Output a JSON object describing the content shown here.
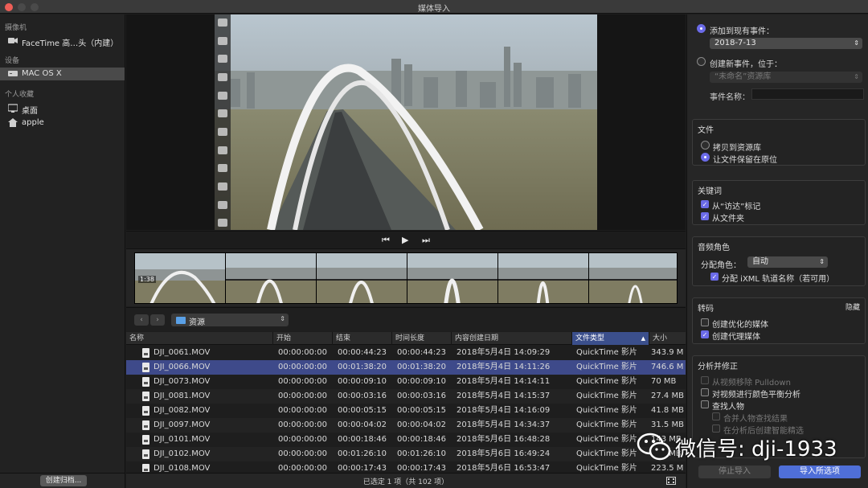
{
  "window": {
    "title": "媒体导入"
  },
  "sidebar": {
    "sections": [
      {
        "header": "摄像机",
        "items": [
          {
            "label": "FaceTime 高…头（内建）",
            "icon": "camera-icon"
          }
        ]
      },
      {
        "header": "设备",
        "items": [
          {
            "label": "MAC OS X",
            "icon": "drive-icon",
            "selected": true
          }
        ]
      },
      {
        "header": "个人收藏",
        "items": [
          {
            "label": "桌面",
            "icon": "desktop-icon"
          },
          {
            "label": "apple",
            "icon": "home-icon"
          }
        ]
      }
    ],
    "create_archive_label": "创建归档..."
  },
  "viewer": {
    "clip_duration": "1:38"
  },
  "browser": {
    "folder": "资源"
  },
  "table": {
    "columns": [
      "名称",
      "开始",
      "结束",
      "时间长度",
      "内容创建日期",
      "文件类型",
      "大小"
    ],
    "sorted_column": "文件类型",
    "rows": [
      [
        "DJI_0061.MOV",
        "00:00:00:00",
        "00:00:44:23",
        "00:00:44:23",
        "2018年5月4日 14:09:29",
        "QuickTime 影片",
        "343.9 M"
      ],
      [
        "DJI_0066.MOV",
        "00:00:00:00",
        "00:01:38:20",
        "00:01:38:20",
        "2018年5月4日 14:11:26",
        "QuickTime 影片",
        "746.6 M"
      ],
      [
        "DJI_0073.MOV",
        "00:00:00:00",
        "00:00:09:10",
        "00:00:09:10",
        "2018年5月4日 14:14:11",
        "QuickTime 影片",
        "70 MB"
      ],
      [
        "DJI_0081.MOV",
        "00:00:00:00",
        "00:00:03:16",
        "00:00:03:16",
        "2018年5月4日 14:15:37",
        "QuickTime 影片",
        "27.4 MB"
      ],
      [
        "DJI_0082.MOV",
        "00:00:00:00",
        "00:00:05:15",
        "00:00:05:15",
        "2018年5月4日 14:16:09",
        "QuickTime 影片",
        "41.8 MB"
      ],
      [
        "DJI_0097.MOV",
        "00:00:00:00",
        "00:00:04:02",
        "00:00:04:02",
        "2018年5月4日 14:34:37",
        "QuickTime 影片",
        "31.5 MB"
      ],
      [
        "DJI_0101.MOV",
        "00:00:00:00",
        "00:00:18:46",
        "00:00:18:46",
        "2018年5月6日 16:48:28",
        "QuickTime 影片",
        "143 MB"
      ],
      [
        "DJI_0102.MOV",
        "00:00:00:00",
        "00:01:26:10",
        "00:01:26:10",
        "2018年5月6日 16:49:24",
        "QuickTime 影片",
        "653 MB"
      ],
      [
        "DJI_0108.MOV",
        "00:00:00:00",
        "00:00:17:43",
        "00:00:17:43",
        "2018年5月6日 16:53:47",
        "QuickTime 影片",
        "223.5 M"
      ]
    ],
    "selected_row": 1
  },
  "status": {
    "text": "已选定 1 项（共 102 项）"
  },
  "right_panel": {
    "add_existing_label": "添加到现有事件：",
    "existing_event": "2018-7-13",
    "create_new_label": "创建新事件，位于：",
    "new_event_library": "“未命名”资源库",
    "event_name_label": "事件名称：",
    "files": {
      "title": "文件",
      "copy_label": "拷贝到资源库",
      "leave_label": "让文件保留在原位"
    },
    "keywords": {
      "title": "关键词",
      "finder_tags": "从“访达”标记",
      "from_folders": "从文件夹"
    },
    "audio_roles": {
      "title": "音频角色",
      "assign_label": "分配角色：",
      "assign_value": "自动",
      "ixml_label": "分配 iXML 轨道名称（若可用）"
    },
    "transcode": {
      "title": "转码",
      "hide_label": "隐藏",
      "optimized": "创建优化的媒体",
      "proxy": "创建代理媒体"
    },
    "analyze": {
      "title": "分析并修正",
      "pulldown": "从视频移除 Pulldown",
      "color_balance": "对视频进行颜色平衡分析",
      "find_people": "查找人物",
      "consolidate": "合并人物查找结果",
      "smart": "在分析后创建智能精选"
    },
    "stop_import_label": "停止导入",
    "import_label": "导入所选项"
  },
  "watermark": {
    "text": "微信号: dji-1933"
  },
  "colors": {
    "accent": "#6b6be8",
    "selection": "#3e4a8a",
    "import_button": "#4f6fd8"
  }
}
